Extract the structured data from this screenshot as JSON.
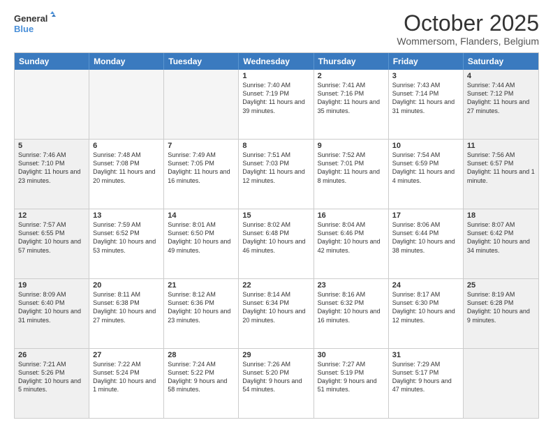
{
  "header": {
    "logo_line1": "General",
    "logo_line2": "Blue",
    "month": "October 2025",
    "location": "Wommersom, Flanders, Belgium"
  },
  "days_of_week": [
    "Sunday",
    "Monday",
    "Tuesday",
    "Wednesday",
    "Thursday",
    "Friday",
    "Saturday"
  ],
  "rows": [
    [
      {
        "day": "",
        "info": "",
        "empty": true
      },
      {
        "day": "",
        "info": "",
        "empty": true
      },
      {
        "day": "",
        "info": "",
        "empty": true
      },
      {
        "day": "1",
        "info": "Sunrise: 7:40 AM\nSunset: 7:19 PM\nDaylight: 11 hours\nand 39 minutes.",
        "empty": false
      },
      {
        "day": "2",
        "info": "Sunrise: 7:41 AM\nSunset: 7:16 PM\nDaylight: 11 hours\nand 35 minutes.",
        "empty": false
      },
      {
        "day": "3",
        "info": "Sunrise: 7:43 AM\nSunset: 7:14 PM\nDaylight: 11 hours\nand 31 minutes.",
        "empty": false
      },
      {
        "day": "4",
        "info": "Sunrise: 7:44 AM\nSunset: 7:12 PM\nDaylight: 11 hours\nand 27 minutes.",
        "empty": false,
        "shaded": true
      }
    ],
    [
      {
        "day": "5",
        "info": "Sunrise: 7:46 AM\nSunset: 7:10 PM\nDaylight: 11 hours\nand 23 minutes.",
        "empty": false,
        "shaded": true
      },
      {
        "day": "6",
        "info": "Sunrise: 7:48 AM\nSunset: 7:08 PM\nDaylight: 11 hours\nand 20 minutes.",
        "empty": false
      },
      {
        "day": "7",
        "info": "Sunrise: 7:49 AM\nSunset: 7:05 PM\nDaylight: 11 hours\nand 16 minutes.",
        "empty": false
      },
      {
        "day": "8",
        "info": "Sunrise: 7:51 AM\nSunset: 7:03 PM\nDaylight: 11 hours\nand 12 minutes.",
        "empty": false
      },
      {
        "day": "9",
        "info": "Sunrise: 7:52 AM\nSunset: 7:01 PM\nDaylight: 11 hours\nand 8 minutes.",
        "empty": false
      },
      {
        "day": "10",
        "info": "Sunrise: 7:54 AM\nSunset: 6:59 PM\nDaylight: 11 hours\nand 4 minutes.",
        "empty": false
      },
      {
        "day": "11",
        "info": "Sunrise: 7:56 AM\nSunset: 6:57 PM\nDaylight: 11 hours\nand 1 minute.",
        "empty": false,
        "shaded": true
      }
    ],
    [
      {
        "day": "12",
        "info": "Sunrise: 7:57 AM\nSunset: 6:55 PM\nDaylight: 10 hours\nand 57 minutes.",
        "empty": false,
        "shaded": true
      },
      {
        "day": "13",
        "info": "Sunrise: 7:59 AM\nSunset: 6:52 PM\nDaylight: 10 hours\nand 53 minutes.",
        "empty": false
      },
      {
        "day": "14",
        "info": "Sunrise: 8:01 AM\nSunset: 6:50 PM\nDaylight: 10 hours\nand 49 minutes.",
        "empty": false
      },
      {
        "day": "15",
        "info": "Sunrise: 8:02 AM\nSunset: 6:48 PM\nDaylight: 10 hours\nand 46 minutes.",
        "empty": false
      },
      {
        "day": "16",
        "info": "Sunrise: 8:04 AM\nSunset: 6:46 PM\nDaylight: 10 hours\nand 42 minutes.",
        "empty": false
      },
      {
        "day": "17",
        "info": "Sunrise: 8:06 AM\nSunset: 6:44 PM\nDaylight: 10 hours\nand 38 minutes.",
        "empty": false
      },
      {
        "day": "18",
        "info": "Sunrise: 8:07 AM\nSunset: 6:42 PM\nDaylight: 10 hours\nand 34 minutes.",
        "empty": false,
        "shaded": true
      }
    ],
    [
      {
        "day": "19",
        "info": "Sunrise: 8:09 AM\nSunset: 6:40 PM\nDaylight: 10 hours\nand 31 minutes.",
        "empty": false,
        "shaded": true
      },
      {
        "day": "20",
        "info": "Sunrise: 8:11 AM\nSunset: 6:38 PM\nDaylight: 10 hours\nand 27 minutes.",
        "empty": false
      },
      {
        "day": "21",
        "info": "Sunrise: 8:12 AM\nSunset: 6:36 PM\nDaylight: 10 hours\nand 23 minutes.",
        "empty": false
      },
      {
        "day": "22",
        "info": "Sunrise: 8:14 AM\nSunset: 6:34 PM\nDaylight: 10 hours\nand 20 minutes.",
        "empty": false
      },
      {
        "day": "23",
        "info": "Sunrise: 8:16 AM\nSunset: 6:32 PM\nDaylight: 10 hours\nand 16 minutes.",
        "empty": false
      },
      {
        "day": "24",
        "info": "Sunrise: 8:17 AM\nSunset: 6:30 PM\nDaylight: 10 hours\nand 12 minutes.",
        "empty": false
      },
      {
        "day": "25",
        "info": "Sunrise: 8:19 AM\nSunset: 6:28 PM\nDaylight: 10 hours\nand 9 minutes.",
        "empty": false,
        "shaded": true
      }
    ],
    [
      {
        "day": "26",
        "info": "Sunrise: 7:21 AM\nSunset: 5:26 PM\nDaylight: 10 hours\nand 5 minutes.",
        "empty": false,
        "shaded": true
      },
      {
        "day": "27",
        "info": "Sunrise: 7:22 AM\nSunset: 5:24 PM\nDaylight: 10 hours\nand 1 minute.",
        "empty": false
      },
      {
        "day": "28",
        "info": "Sunrise: 7:24 AM\nSunset: 5:22 PM\nDaylight: 9 hours\nand 58 minutes.",
        "empty": false
      },
      {
        "day": "29",
        "info": "Sunrise: 7:26 AM\nSunset: 5:20 PM\nDaylight: 9 hours\nand 54 minutes.",
        "empty": false
      },
      {
        "day": "30",
        "info": "Sunrise: 7:27 AM\nSunset: 5:19 PM\nDaylight: 9 hours\nand 51 minutes.",
        "empty": false
      },
      {
        "day": "31",
        "info": "Sunrise: 7:29 AM\nSunset: 5:17 PM\nDaylight: 9 hours\nand 47 minutes.",
        "empty": false
      },
      {
        "day": "",
        "info": "",
        "empty": true,
        "shaded": true
      }
    ]
  ]
}
